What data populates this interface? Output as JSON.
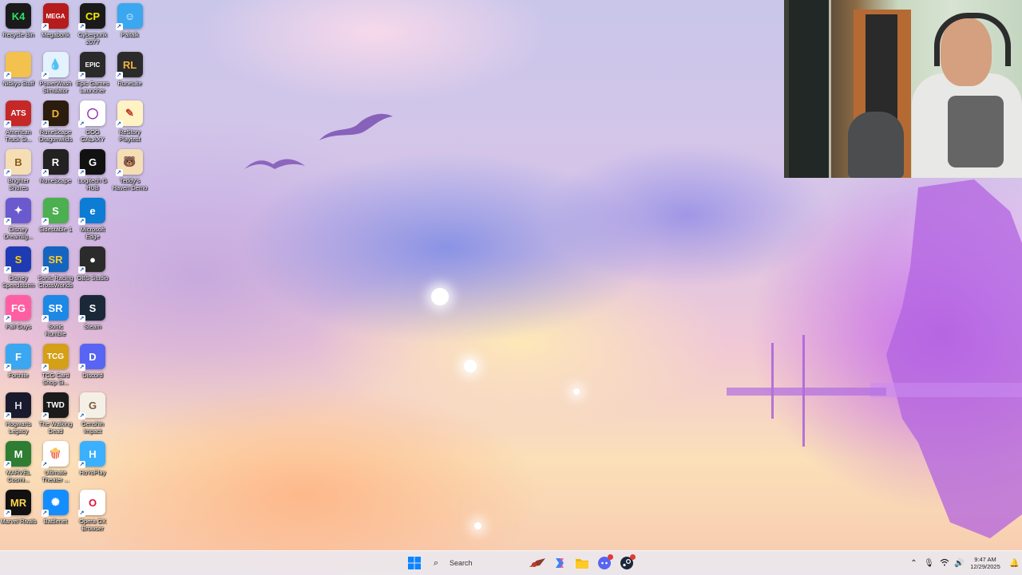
{
  "desktop": {
    "icons": [
      {
        "label": "Recycle Bin",
        "glyph": "K4",
        "color": "#1a1a1a",
        "text_color": "#2ee06a"
      },
      {
        "label": "Nickys Stuff",
        "glyph": "",
        "color": "#f2c14e",
        "text_color": "#ffffff"
      },
      {
        "label": "American\nTruck Si...",
        "glyph": "ATS",
        "color": "#c62828",
        "text_color": "#ffffff"
      },
      {
        "label": "Brighter\nShores",
        "glyph": "B",
        "color": "#f5deb3",
        "text_color": "#8a5a1a"
      },
      {
        "label": "Disney\nDreamlig...",
        "glyph": "✦",
        "color": "#6a5acd",
        "text_color": "#ffffff"
      },
      {
        "label": "Disney\nSpeedstorm",
        "glyph": "S",
        "color": "#1f3bb3",
        "text_color": "#ffd200"
      },
      {
        "label": "Fall Guys",
        "glyph": "FG",
        "color": "#ff5fa2",
        "text_color": "#ffffff"
      },
      {
        "label": "Fortnite",
        "glyph": "F",
        "color": "#3aa7f0",
        "text_color": "#ffffff"
      },
      {
        "label": "Hogwarts\nLegacy",
        "glyph": "H",
        "color": "#1a1a2e",
        "text_color": "#cfd8dc"
      },
      {
        "label": "MARVEL\nCosmi...",
        "glyph": "M",
        "color": "#2e7d32",
        "text_color": "#ffffff"
      },
      {
        "label": "Marvel Rivals",
        "glyph": "MR",
        "color": "#111111",
        "text_color": "#ffd54f"
      },
      {
        "label": "Megabonk",
        "glyph": "MEGA",
        "color": "#b71c1c",
        "text_color": "#ffffff"
      },
      {
        "label": "PowerWash\nSimulator",
        "glyph": "💧",
        "color": "#e3f2fd",
        "text_color": "#1565c0"
      },
      {
        "label": "RuneScape\nDragonwilds",
        "glyph": "D",
        "color": "#2b1d0e",
        "text_color": "#f5b041"
      },
      {
        "label": "RuneScape",
        "glyph": "R",
        "color": "#222222",
        "text_color": "#ffffff"
      },
      {
        "label": "Sidestable 1",
        "glyph": "S",
        "color": "#4caf50",
        "text_color": "#ffffff"
      },
      {
        "label": "Sonic Racing\nCrossWorlds",
        "glyph": "SR",
        "color": "#1565c0",
        "text_color": "#ffca28"
      },
      {
        "label": "Sonic\nRumble",
        "glyph": "SR",
        "color": "#1e88e5",
        "text_color": "#ffffff"
      },
      {
        "label": "TCG Card\nShop Si...",
        "glyph": "TCG",
        "color": "#d4a017",
        "text_color": "#ffffff"
      },
      {
        "label": "The Walking\nDead",
        "glyph": "TWD",
        "color": "#1b1b1b",
        "text_color": "#ffffff"
      },
      {
        "label": "Ultimate\nTheater ...",
        "glyph": "🍿",
        "color": "#ffffff",
        "text_color": "#c62828"
      },
      {
        "label": "Battlenet",
        "glyph": "✺",
        "color": "#148eff",
        "text_color": "#ffffff"
      },
      {
        "label": "Cyberpunk\n2077",
        "glyph": "CP",
        "color": "#1a1a1a",
        "text_color": "#f3e600"
      },
      {
        "label": "Epic Games\nLauncher",
        "glyph": "EPIC",
        "color": "#2a2a2a",
        "text_color": "#ffffff"
      },
      {
        "label": "GOG GALAXY",
        "glyph": "◯",
        "color": "#ffffff",
        "text_color": "#8e24aa"
      },
      {
        "label": "Logitech G\nHUB",
        "glyph": "G",
        "color": "#111111",
        "text_color": "#ffffff"
      },
      {
        "label": "Microsoft\nEdge",
        "glyph": "e",
        "color": "#0c7cd5",
        "text_color": "#ffffff"
      },
      {
        "label": "OBS Studio",
        "glyph": "●",
        "color": "#2b2b2b",
        "text_color": "#ffffff"
      },
      {
        "label": "Steam",
        "glyph": "S",
        "color": "#1b2838",
        "text_color": "#ffffff"
      },
      {
        "label": "Discord",
        "glyph": "D",
        "color": "#5865f2",
        "text_color": "#ffffff"
      },
      {
        "label": "Genshin\nImpact",
        "glyph": "G",
        "color": "#f5f0e6",
        "text_color": "#7a5c3a"
      },
      {
        "label": "HoYoPlay",
        "glyph": "H",
        "color": "#3ab0ff",
        "text_color": "#ffffff"
      },
      {
        "label": "Opera GX\nBrowser",
        "glyph": "O",
        "color": "#ffffff",
        "text_color": "#e0143c"
      },
      {
        "label": "Paltalk",
        "glyph": "☺",
        "color": "#3aa7f0",
        "text_color": "#ffffff"
      },
      {
        "label": "RuneLite",
        "glyph": "RL",
        "color": "#2b2b2b",
        "text_color": "#f5b041"
      },
      {
        "label": "ReStory\nPlaytest",
        "glyph": "✎",
        "color": "#fff3c4",
        "text_color": "#c0392b"
      },
      {
        "label": "Teddy's\nHaven Demo",
        "glyph": "🐻",
        "color": "#f5deb3",
        "text_color": "#6d4c41"
      }
    ]
  },
  "taskbar": {
    "search_label": "Search",
    "pinned": [
      {
        "name": "start-button",
        "icon": "windows-logo-icon"
      },
      {
        "name": "search-box",
        "icon": "search-icon"
      },
      {
        "name": "taskbar-app-game",
        "icon": "game-app-icon"
      },
      {
        "name": "taskbar-app-copilot",
        "icon": "copilot-icon"
      },
      {
        "name": "taskbar-app-file-explorer",
        "icon": "folder-icon"
      },
      {
        "name": "taskbar-app-discord",
        "icon": "discord-icon"
      },
      {
        "name": "taskbar-app-steam",
        "icon": "steam-icon"
      }
    ],
    "tray": {
      "time": "9:47 AM",
      "date": "12/29/2025"
    }
  },
  "colors": {
    "accent": "#0067c0",
    "notification_badge": "#e53935"
  }
}
